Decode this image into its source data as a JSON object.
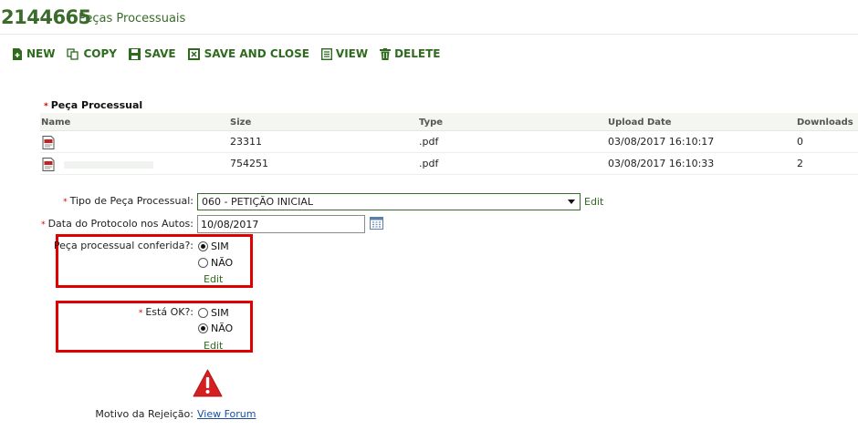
{
  "header": {
    "record_id": "2144665",
    "record_type": "Peças Processuais"
  },
  "toolbar": {
    "new": "NEW",
    "copy": "COPY",
    "save": "SAVE",
    "save_and_close": "SAVE AND CLOSE",
    "view": "VIEW",
    "delete": "DELETE"
  },
  "files_section": {
    "required_mark": "*",
    "title": "Peça Processual",
    "columns": [
      "Name",
      "Size",
      "Type",
      "Upload Date",
      "Downloads"
    ],
    "rows": [
      {
        "name": "",
        "size": "23311",
        "type": ".pdf",
        "upload_date": "03/08/2017 16:10:17",
        "downloads": "0"
      },
      {
        "name": "",
        "size": "754251",
        "type": ".pdf",
        "upload_date": "03/08/2017 16:10:33",
        "downloads": "2"
      }
    ]
  },
  "form": {
    "tipo": {
      "required_mark": "*",
      "label": "Tipo de Peça Processual:",
      "value": "060 - PETIÇÃO INICIAL",
      "edit": "Edit"
    },
    "data": {
      "required_mark": "*",
      "label": "Data do Protocolo nos Autos:",
      "value": "10/08/2017"
    },
    "conferida": {
      "label": "Peça processual conferida?:",
      "options": [
        "SIM",
        "NÃO"
      ],
      "selected": "SIM",
      "edit": "Edit"
    },
    "esta_ok": {
      "required_mark": "*",
      "label": "Está OK?:",
      "options": [
        "SIM",
        "NÃO"
      ],
      "selected": "NÃO",
      "edit": "Edit"
    },
    "motivo": {
      "label": "Motivo da Rejeição:",
      "link": "View Forum"
    }
  },
  "colors": {
    "accent": "#2e6b1e",
    "highlight": "#e00000",
    "warning": "#d42020"
  }
}
